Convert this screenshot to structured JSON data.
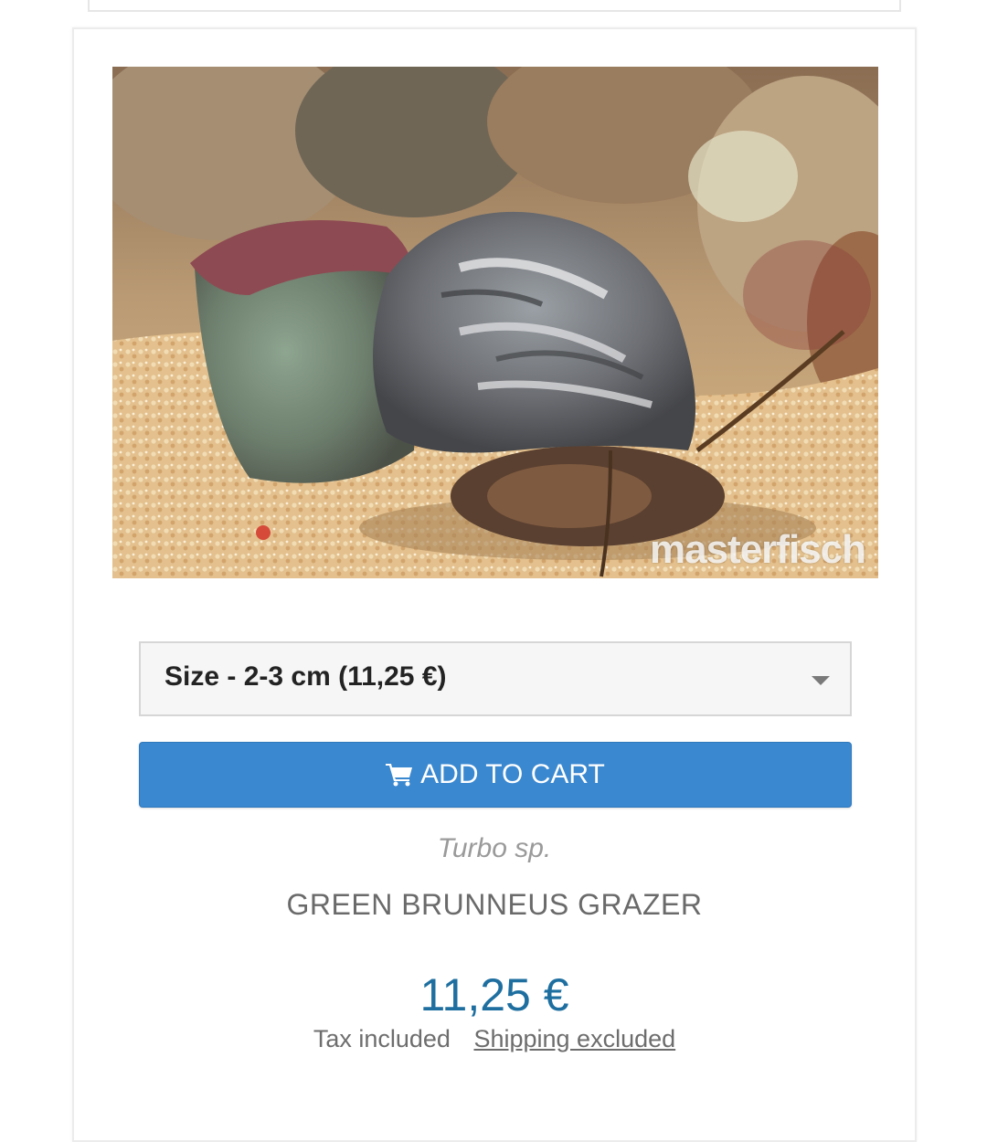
{
  "product": {
    "image_watermark": "masterfisch",
    "size_select": {
      "selected": "Size - 2-3 cm (11,25 €)"
    },
    "add_to_cart_label": "ADD TO CART",
    "scientific_name": "Turbo sp.",
    "name": "GREEN BRUNNEUS GRAZER",
    "price": "11,25 €",
    "tax_note": "Tax included",
    "shipping_link": "Shipping excluded"
  },
  "colors": {
    "button": "#3a88d0",
    "price": "#1e6fa0"
  },
  "icons": {
    "cart": "shopping-cart-icon",
    "caret": "chevron-down-icon"
  }
}
